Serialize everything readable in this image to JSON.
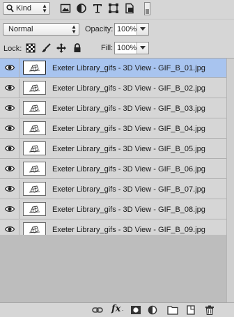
{
  "filter": {
    "kind_label": "Kind"
  },
  "blend": {
    "mode": "Normal",
    "opacity_label": "Opacity:",
    "opacity_value": "100%"
  },
  "lock": {
    "label": "Lock:",
    "fill_label": "Fill:",
    "fill_value": "100%"
  },
  "layers": [
    {
      "name": "Exeter Library_gifs - 3D View - GIF_B_01.jpg",
      "selected": true
    },
    {
      "name": "Exeter Library_gifs - 3D View - GIF_B_02.jpg",
      "selected": false
    },
    {
      "name": "Exeter Library_gifs - 3D View - GIF_B_03.jpg",
      "selected": false
    },
    {
      "name": "Exeter Library_gifs - 3D View - GIF_B_04.jpg",
      "selected": false
    },
    {
      "name": "Exeter Library_gifs - 3D View - GIF_B_05.jpg",
      "selected": false
    },
    {
      "name": "Exeter Library_gifs - 3D View - GIF_B_06.jpg",
      "selected": false
    },
    {
      "name": "Exeter Library_gifs - 3D View - GIF_B_07.jpg",
      "selected": false
    },
    {
      "name": "Exeter Library_gifs - 3D View - GIF_B_08.jpg",
      "selected": false
    },
    {
      "name": "Exeter Library_gifs - 3D View - GIF_B_09.jpg",
      "selected": false
    }
  ],
  "toolbar": {
    "fx_label": "fx",
    "icons": [
      "link-layers-icon",
      "fx-icon",
      "add-mask-icon",
      "adjustment-layer-icon",
      "new-group-icon",
      "new-layer-icon",
      "delete-layer-icon"
    ]
  },
  "colors": {
    "panel": "#d6d6d6",
    "selected_row": "#a8c4ef",
    "empty_area": "#bdbdbd"
  }
}
